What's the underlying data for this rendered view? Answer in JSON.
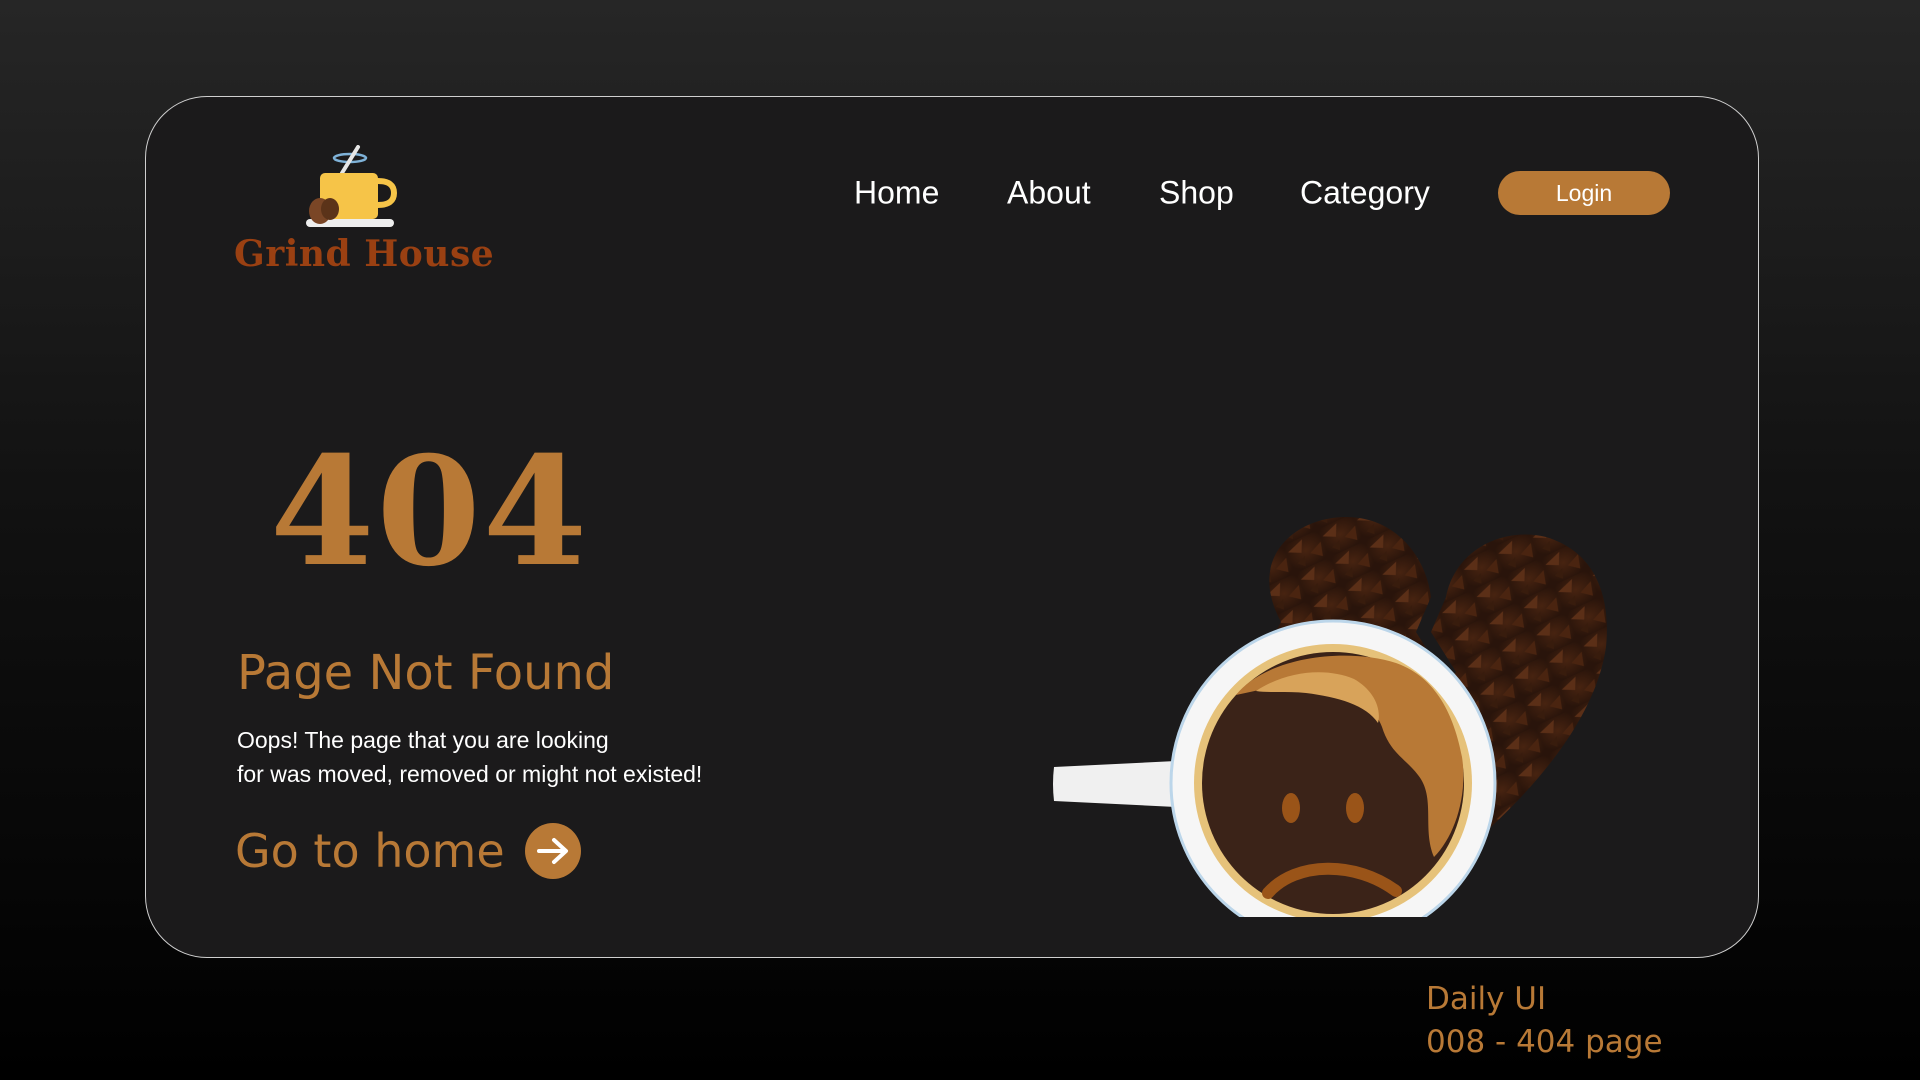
{
  "brand": {
    "name": "Grind House",
    "logo_icon": "coffee-cup-icon",
    "color": "#9a4012"
  },
  "nav": {
    "items": [
      {
        "label": "Home"
      },
      {
        "label": "About"
      },
      {
        "label": "Shop"
      },
      {
        "label": "Category"
      }
    ],
    "login_label": "Login"
  },
  "error": {
    "code": "404",
    "title": "Page Not Found",
    "message_line1": "Oops! The page that you are looking",
    "message_line2": "for was moved, removed or might not existed!",
    "cta_label": "Go to home",
    "cta_icon": "arrow-right-icon"
  },
  "illustration": {
    "name": "sad-coffee-cup-with-broken-heart-of-beans",
    "icons": [
      "coffee-mug-icon",
      "broken-heart-icon",
      "sad-face-icon"
    ]
  },
  "credit": {
    "line1": "Daily UI",
    "line2": "008 - 404 page"
  },
  "colors": {
    "accent": "#b87936",
    "panel": "#1b1a1b",
    "text": "#ffffff",
    "border": "#cfcfcf"
  }
}
